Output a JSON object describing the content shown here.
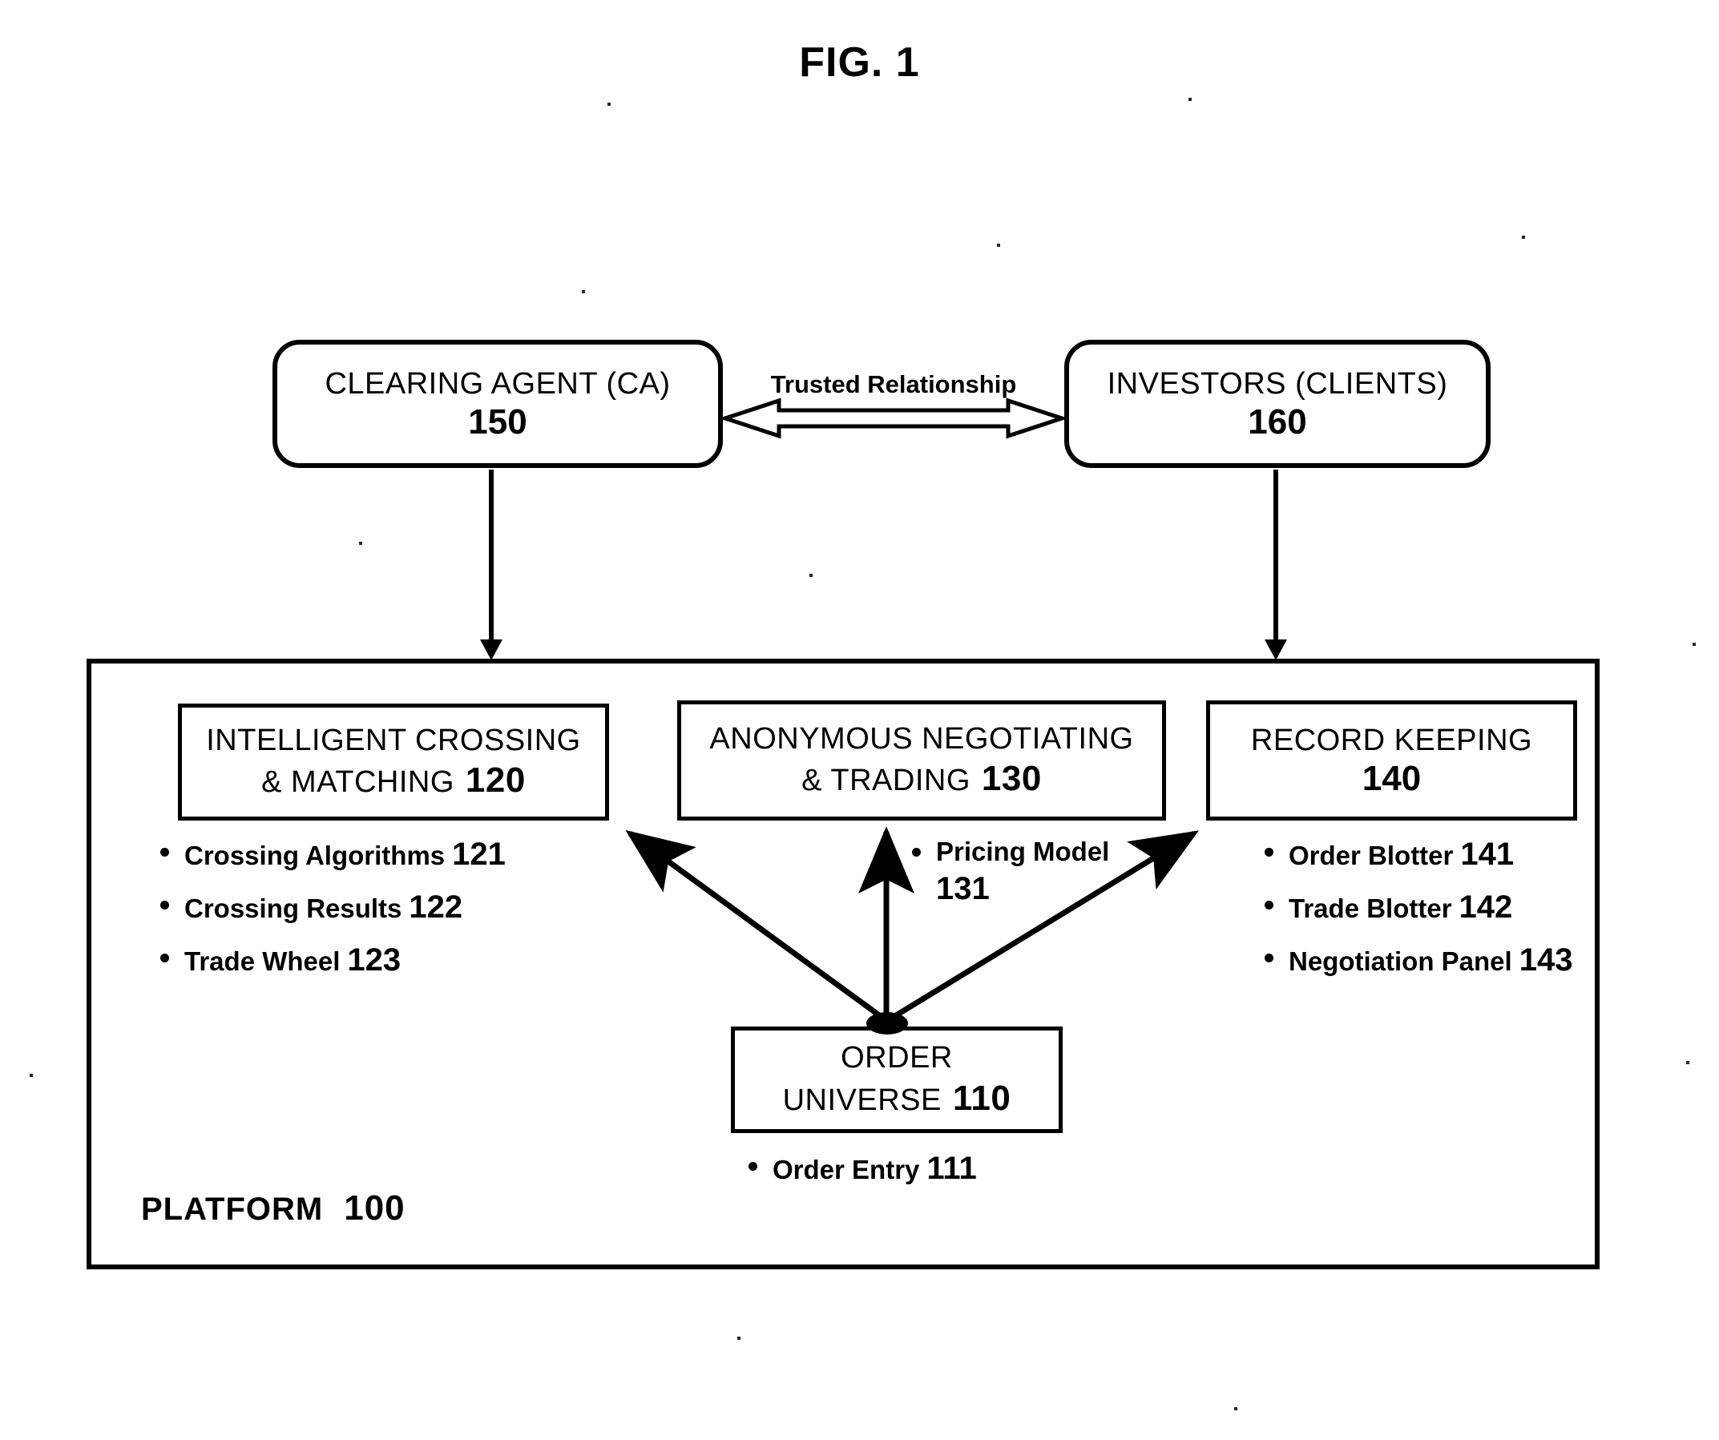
{
  "figure": {
    "title": "FIG. 1"
  },
  "top_nodes": {
    "clearing_agent": {
      "label": "CLEARING AGENT (CA)",
      "ref": "150"
    },
    "investors": {
      "label": "INVESTORS (CLIENTS)",
      "ref": "160"
    },
    "relationship_label": "Trusted Relationship"
  },
  "platform": {
    "label": "PLATFORM",
    "ref": "100",
    "modules": [
      {
        "line1": "INTELLIGENT CROSSING",
        "line2": "& MATCHING",
        "ref": "120",
        "items": [
          {
            "text": "Crossing Algorithms",
            "ref": "121"
          },
          {
            "text": "Crossing Results",
            "ref": "122"
          },
          {
            "text": "Trade Wheel",
            "ref": "123"
          }
        ]
      },
      {
        "line1": "ANONYMOUS NEGOTIATING",
        "line2": "& TRADING",
        "ref": "130",
        "items": [
          {
            "text": "Pricing Model",
            "ref": "131"
          }
        ]
      },
      {
        "line1": "RECORD KEEPING",
        "line2": "",
        "ref": "140",
        "items": [
          {
            "text": "Order Blotter",
            "ref": "141"
          },
          {
            "text": "Trade Blotter",
            "ref": "142"
          },
          {
            "text": "Negotiation Panel",
            "ref": "143"
          }
        ]
      }
    ],
    "order_universe": {
      "line1": "ORDER",
      "line2": "UNIVERSE",
      "ref": "110",
      "items": [
        {
          "text": "Order Entry",
          "ref": "111"
        }
      ]
    }
  },
  "colors": {
    "ink": "#000000",
    "paper": "#ffffff"
  }
}
